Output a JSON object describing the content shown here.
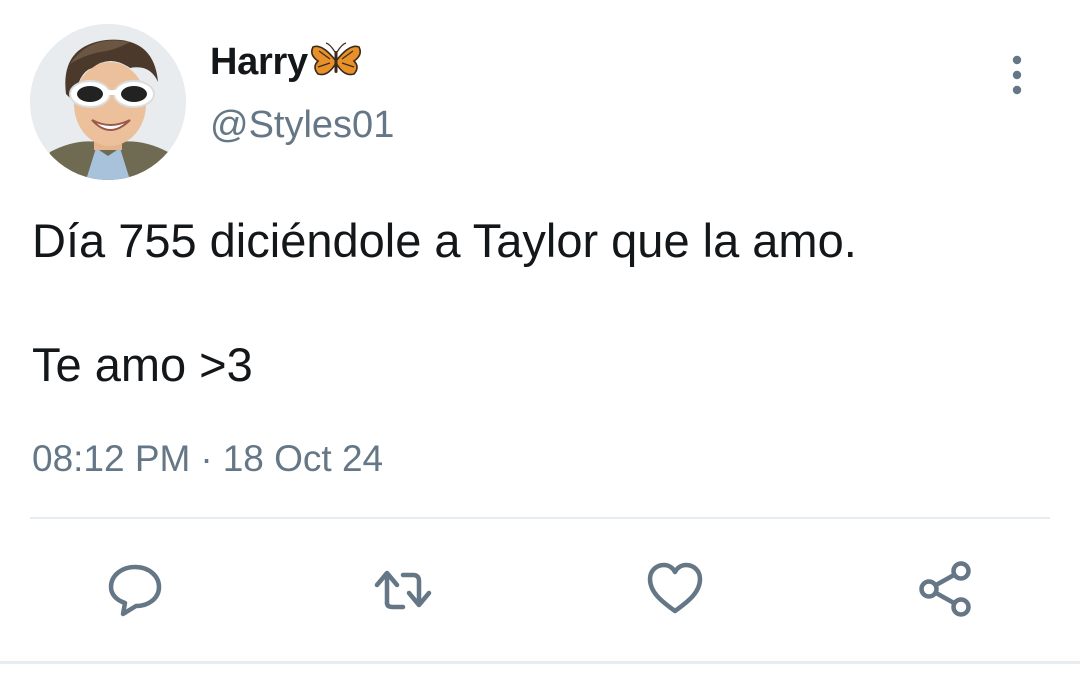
{
  "author": {
    "display_name": "Harry",
    "handle": "@Styles01",
    "name_emoji": "butterfly-icon"
  },
  "tweet": {
    "lines": [
      "Día 755 diciéndole a Taylor que la amo.",
      "Te amo >3"
    ],
    "time": "08:12 PM",
    "separator": "·",
    "date": "18 Oct 24"
  },
  "actions": [
    {
      "name": "reply",
      "icon": "comment-icon"
    },
    {
      "name": "retweet",
      "icon": "retweet-icon"
    },
    {
      "name": "like",
      "icon": "heart-icon"
    },
    {
      "name": "share",
      "icon": "share-icon"
    }
  ],
  "colors": {
    "text": "#14171a",
    "secondary": "#657786",
    "divider": "#e6ecf0",
    "butterfly": "#e8902a"
  }
}
